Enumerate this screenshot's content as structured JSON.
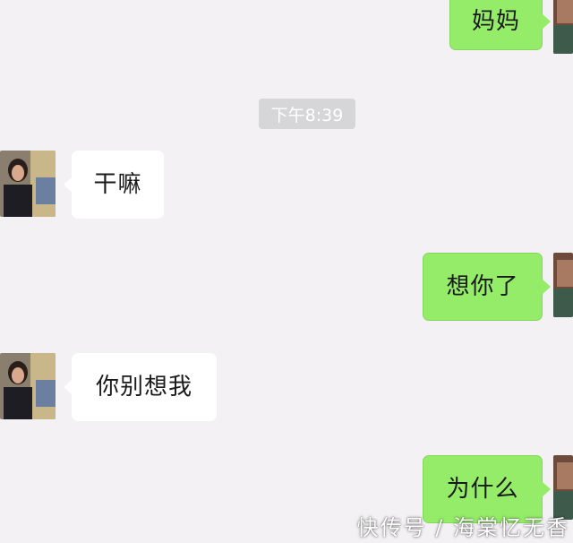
{
  "timestamp": "下午8:39",
  "messages": [
    {
      "side": "out",
      "text": "妈妈"
    },
    {
      "side": "in",
      "text": "干嘛"
    },
    {
      "side": "out",
      "text": "想你了"
    },
    {
      "side": "in",
      "text": "你别想我"
    },
    {
      "side": "out",
      "text": "为什么"
    }
  ],
  "watermark": "快传号 / 海棠忆无香",
  "colors": {
    "outgoing_bubble": "#95ec69",
    "incoming_bubble": "#ffffff",
    "background": "#f3f1f3",
    "timestamp_pill": "#d6d6d9"
  }
}
